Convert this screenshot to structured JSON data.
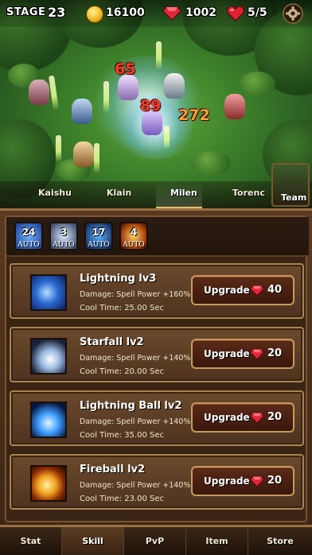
{
  "hud": {
    "stage_label": "STAGE",
    "stage_number": "23",
    "gold": "16100",
    "gems": "1002",
    "lives": "5/5",
    "icons": [
      "coin-icon",
      "gem-icon",
      "heart-icon",
      "gear-icon"
    ]
  },
  "battle": {
    "damage_numbers": [
      "65",
      "89",
      "272"
    ]
  },
  "heroes": {
    "tabs": [
      "Kaishu",
      "Klain",
      "Milen",
      "Torenc"
    ],
    "active": "Milen",
    "team_label": "Team"
  },
  "skill_slots": [
    {
      "count": "24",
      "mode": "AUTO",
      "icon": "lightning-icon"
    },
    {
      "count": "3",
      "mode": "AUTO",
      "icon": "starfall-icon"
    },
    {
      "count": "17",
      "mode": "AUTO",
      "icon": "lightning-ball-icon"
    },
    {
      "count": "4",
      "mode": "AUTO",
      "icon": "fireball-icon"
    }
  ],
  "skills": [
    {
      "name": "Lightning lv3",
      "damage": "Damage: Spell Power +160%",
      "cool": "Cool Time: 25.00 Sec",
      "upgrade_label": "Upgrade",
      "cost": "40"
    },
    {
      "name": "Starfall lv2",
      "damage": "Damage: Spell Power +140%",
      "cool": "Cool Time: 20.00 Sec",
      "upgrade_label": "Upgrade",
      "cost": "20"
    },
    {
      "name": "Lightning Ball lv2",
      "damage": "Damage: Spell Power +140%",
      "cool": "Cool Time: 35.00 Sec",
      "upgrade_label": "Upgrade",
      "cost": "20"
    },
    {
      "name": "Fireball lv2",
      "damage": "Damage: Spell Power +140%",
      "cool": "Cool Time: 23.00 Sec",
      "upgrade_label": "Upgrade",
      "cost": "20"
    }
  ],
  "nav": {
    "tabs": [
      "Stat",
      "Skill",
      "PvP",
      "Item",
      "Store"
    ],
    "active": "Skill"
  },
  "colors": {
    "panel_brown": "#4e3320",
    "border_gold": "#a9844e",
    "gem_red": "#e0283a",
    "damage_red": "#ff3a2a"
  }
}
